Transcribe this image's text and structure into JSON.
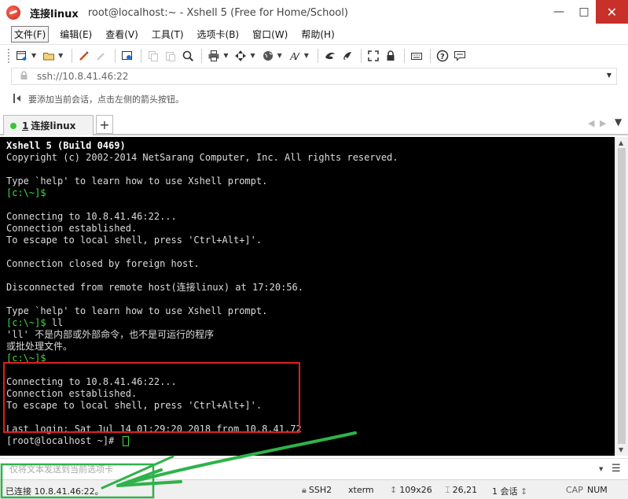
{
  "window": {
    "session_title": "连接linux",
    "title_rest": "root@localhost:~ - Xshell 5 (Free for Home/School)",
    "min_glyph": "—",
    "max_glyph": "□",
    "close_glyph": "✕"
  },
  "menu": {
    "items": [
      "文件(F)",
      "编辑(E)",
      "查看(V)",
      "工具(T)",
      "选项卡(B)",
      "窗口(W)",
      "帮助(H)"
    ]
  },
  "toolbar": {
    "icons": [
      "new-session-icon",
      "open-folder-icon",
      "reconnect-icon",
      "disconnect-icon",
      "properties-icon",
      "copy-icon",
      "paste-icon",
      "find-icon",
      "print-icon",
      "transfer-icon",
      "globe-icon",
      "font-icon",
      "xftp-icon",
      "xmanager-icon",
      "fullscreen-icon",
      "lock-icon",
      "keyboard-icon",
      "help-icon",
      "chat-icon"
    ]
  },
  "address": {
    "value": "ssh://10.8.41.46:22"
  },
  "hint": {
    "text": "要添加当前会话，点击左侧的箭头按钮。"
  },
  "tabs": {
    "active_number": "1",
    "active_label": "连接linux",
    "add_label": "+"
  },
  "terminal": {
    "lines": [
      {
        "text": "Xshell 5 (Build 0469)",
        "style": "bold"
      },
      {
        "text": "Copyright (c) 2002-2014 NetSarang Computer, Inc. All rights reserved.",
        "style": "normal"
      },
      {
        "text": "",
        "style": "normal"
      },
      {
        "text": "Type `help' to learn how to use Xshell prompt.",
        "style": "normal"
      },
      {
        "prompt": "[c:\\~]$",
        "text": "",
        "style": "normal"
      },
      {
        "text": "",
        "style": "normal"
      },
      {
        "text": "Connecting to 10.8.41.46:22...",
        "style": "normal"
      },
      {
        "text": "Connection established.",
        "style": "normal"
      },
      {
        "text": "To escape to local shell, press 'Ctrl+Alt+]'.",
        "style": "normal"
      },
      {
        "text": "",
        "style": "normal"
      },
      {
        "text": "Connection closed by foreign host.",
        "style": "normal"
      },
      {
        "text": "",
        "style": "normal"
      },
      {
        "text": "Disconnected from remote host(连接linux) at 17:20:56.",
        "style": "normal"
      },
      {
        "text": "",
        "style": "normal"
      },
      {
        "text": "Type `help' to learn how to use Xshell prompt.",
        "style": "normal"
      },
      {
        "prompt": "[c:\\~]$",
        "text": " ll",
        "style": "normal"
      },
      {
        "text": "'ll' 不是内部或外部命令，也不是可运行的程序",
        "style": "normal"
      },
      {
        "text": "或批处理文件。",
        "style": "normal"
      },
      {
        "prompt": "[c:\\~]$",
        "text": "",
        "style": "normal"
      },
      {
        "text": "",
        "style": "normal"
      },
      {
        "text": "Connecting to 10.8.41.46:22...",
        "style": "normal"
      },
      {
        "text": "Connection established.",
        "style": "normal"
      },
      {
        "text": "To escape to local shell, press 'Ctrl+Alt+]'.",
        "style": "normal"
      },
      {
        "text": "",
        "style": "normal"
      },
      {
        "text": "Last login: Sat Jul 14 01:29:20 2018 from 10.8.41.72",
        "style": "normal"
      },
      {
        "text": "[root@localhost ~]# ",
        "style": "normal",
        "cursor": true
      }
    ]
  },
  "compose": {
    "placeholder": "仅将文本发送到当前选项卡"
  },
  "status": {
    "connection": "已连接 10.8.41.46:22。",
    "protocol": "SSH2",
    "terminal_type": "xterm",
    "size": "109x26",
    "cursor_pos": "26,21",
    "sessions": "1 会话",
    "caps": "CAP",
    "num": "NUM"
  },
  "colors": {
    "prompt": "#3edc3e",
    "highlight_box": "#e02020",
    "annotation_arrow": "#2fb24a",
    "close_button": "#c8302a"
  }
}
